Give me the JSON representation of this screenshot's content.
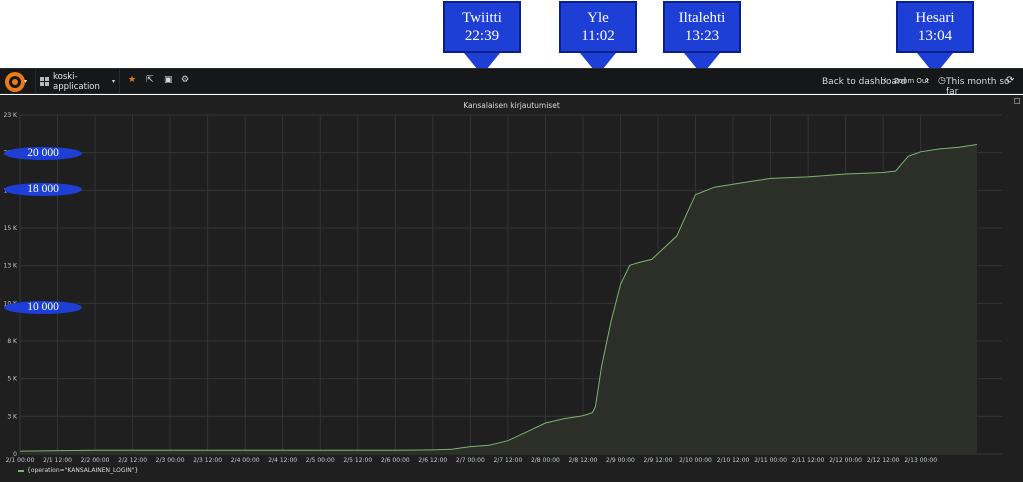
{
  "callouts": [
    {
      "name": "Twiitti",
      "time": "22:39"
    },
    {
      "name": "Yle",
      "time": "11:02"
    },
    {
      "name": "Iltalehti",
      "time": "13:23"
    },
    {
      "name": "Hesari",
      "time": "13:04"
    }
  ],
  "navbar": {
    "dashboard_title": "koski-application",
    "back_label": "Back to dashboard",
    "zoom_label": "Zoom Out",
    "time_range": "This month so far",
    "star_icon": "★",
    "share_icon": "⇱",
    "save_icon": "▣",
    "gear_icon": "⚙",
    "chevron_left": "‹",
    "chevron_right": "›",
    "clock_icon": "◷",
    "refresh_icon": "⟳",
    "caret": "▾"
  },
  "panel": {
    "title": "Kansalaisen kirjautumiset",
    "legend": "{operation=\"KANSALAINEN_LOGIN\"}"
  },
  "annotations_left": [
    "20 000",
    "18 000",
    "10 000"
  ],
  "colors": {
    "series": "#7eb26d",
    "fill": "#2b2f28",
    "annotation": "#1d3fd6",
    "star": "#eb7b18"
  },
  "chart_data": {
    "type": "area",
    "yticks": [
      "0",
      "3 K",
      "5 K",
      "8 K",
      "10 K",
      "13 K",
      "15 K",
      "18 K",
      "20 K",
      "23 K"
    ],
    "ylim": [
      0,
      23000
    ],
    "xticks": [
      "2/1 00:00",
      "2/1 12:00",
      "2/2 00:00",
      "2/2 12:00",
      "2/3 00:00",
      "2/3 12:00",
      "2/4 00:00",
      "2/4 12:00",
      "2/5 00:00",
      "2/5 12:00",
      "2/6 00:00",
      "2/6 12:00",
      "2/7 00:00",
      "2/7 12:00",
      "2/8 00:00",
      "2/8 12:00",
      "2/9 00:00",
      "2/9 12:00",
      "2/10 00:00",
      "2/10 12:00",
      "2/11 00:00",
      "2/11 12:00",
      "2/12 00:00",
      "2/12 12:00",
      "2/13 00:00"
    ],
    "series": [
      {
        "name": "{operation=\"KANSALAINEN_LOGIN\"}",
        "points": [
          [
            "2/1 00:00",
            200
          ],
          [
            "2/2 00:00",
            250
          ],
          [
            "2/3 00:00",
            250
          ],
          [
            "2/4 00:00",
            250
          ],
          [
            "2/5 00:00",
            250
          ],
          [
            "2/6 00:00",
            250
          ],
          [
            "2/6 12:00",
            280
          ],
          [
            "2/6 18:00",
            320
          ],
          [
            "2/7 00:00",
            500
          ],
          [
            "2/7 06:00",
            600
          ],
          [
            "2/7 12:00",
            900
          ],
          [
            "2/7 18:00",
            1500
          ],
          [
            "2/8 00:00",
            2100
          ],
          [
            "2/8 06:00",
            2400
          ],
          [
            "2/8 12:00",
            2600
          ],
          [
            "2/8 15:00",
            2800
          ],
          [
            "2/8 16:00",
            3200
          ],
          [
            "2/8 18:00",
            6000
          ],
          [
            "2/8 21:00",
            9000
          ],
          [
            "2/9 00:00",
            11500
          ],
          [
            "2/9 03:00",
            12800
          ],
          [
            "2/9 06:00",
            13000
          ],
          [
            "2/9 10:00",
            13200
          ],
          [
            "2/9 14:00",
            14000
          ],
          [
            "2/9 18:00",
            14800
          ],
          [
            "2/9 21:00",
            16200
          ],
          [
            "2/10 00:00",
            17600
          ],
          [
            "2/10 06:00",
            18100
          ],
          [
            "2/10 12:00",
            18300
          ],
          [
            "2/10 18:00",
            18500
          ],
          [
            "2/11 00:00",
            18700
          ],
          [
            "2/11 12:00",
            18800
          ],
          [
            "2/12 00:00",
            19000
          ],
          [
            "2/12 12:00",
            19100
          ],
          [
            "2/12 16:00",
            19200
          ],
          [
            "2/12 20:00",
            20200
          ],
          [
            "2/13 00:00",
            20500
          ],
          [
            "2/13 06:00",
            20700
          ],
          [
            "2/13 12:00",
            20800
          ],
          [
            "2/13 18:00",
            21000
          ]
        ]
      }
    ]
  }
}
